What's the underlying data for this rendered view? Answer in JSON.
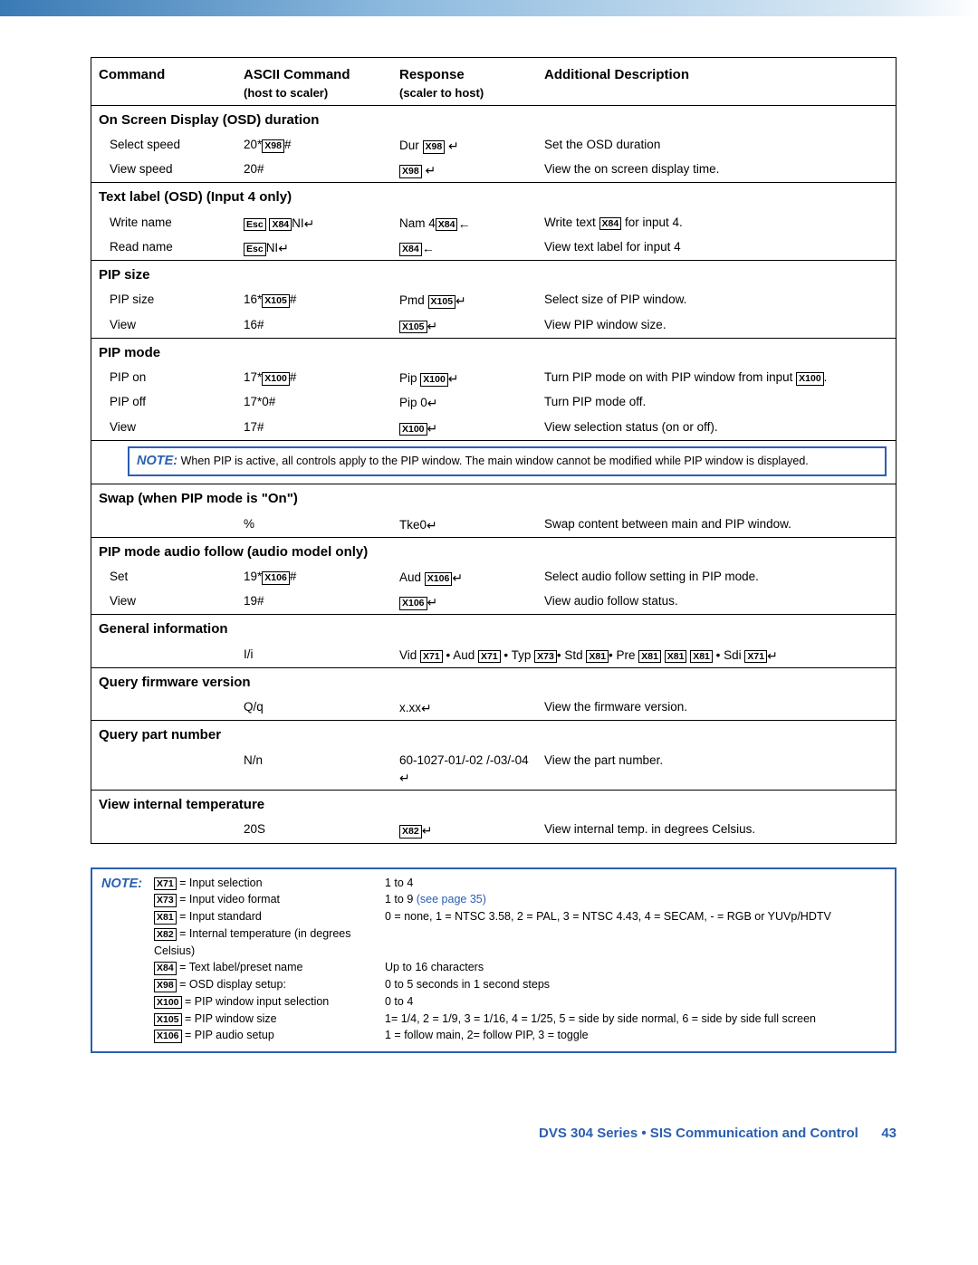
{
  "headers": {
    "c1": "Command",
    "c2": "ASCII Command",
    "c2s": "(host to scaler)",
    "c3": "Response",
    "c3s": "(scaler to host)",
    "c4": "Additional Description"
  },
  "sections": [
    {
      "title": "On Screen Display (OSD) duration",
      "rows": [
        {
          "c1": "Select speed",
          "c2": "20*|X98|#",
          "c3": "Dur |X98| ↵",
          "c4": "Set the OSD duration"
        },
        {
          "c1": "View speed",
          "c2": "20#",
          "c3": "|X98| ↵",
          "c4": "View the on screen display time."
        }
      ]
    },
    {
      "title": "Text label (OSD) (Input 4 only)",
      "rows": [
        {
          "c1": "Write name",
          "c2": "|Esc| |X84|NI↵",
          "c3": "Nam 4|X84|←",
          "c4": "Write text |X84| for input 4."
        },
        {
          "c1": "Read name",
          "c2": "|Esc|NI↵",
          "c3": "|X84|←",
          "c4": "View text label for input 4"
        }
      ]
    },
    {
      "title": "PIP size",
      "rows": [
        {
          "c1": "PIP size",
          "c2": "16*|X105|#",
          "c3": "Pmd |X105|↵",
          "c4": "Select size of PIP window."
        },
        {
          "c1": "View",
          "c2": "16#",
          "c3": "|X105|↵",
          "c4": "View PIP window size."
        }
      ]
    },
    {
      "title": "PIP mode",
      "rows": [
        {
          "c1": "PIP on",
          "c2": "17*|X100|#",
          "c3": "Pip |X100|↵",
          "c4": "Turn PIP mode on with PIP window from input |X100|."
        },
        {
          "c1": "PIP off",
          "c2": "17*0#",
          "c3": "Pip 0↵",
          "c4": "Turn PIP mode off."
        },
        {
          "c1": "View",
          "c2": "17#",
          "c3": "|X100|↵",
          "c4": "View selection status (on or off)."
        }
      ],
      "note": "When PIP is active, all controls apply to the PIP window. The main window cannot be modified while PIP window is displayed."
    },
    {
      "title": "Swap (when PIP mode is \"On\")",
      "rows": [
        {
          "c1": "",
          "c2": "%",
          "c3": "Tke0↵",
          "c4": "Swap content between main and PIP window."
        }
      ]
    },
    {
      "title": "PIP mode audio follow (audio model only)",
      "rows": [
        {
          "c1": "Set",
          "c2": "19*|X106|#",
          "c3": "Aud |X106|↵",
          "c4": "Select audio follow setting in PIP mode."
        },
        {
          "c1": "View",
          "c2": "19#",
          "c3": "|X106|↵",
          "c4": "View audio follow status."
        }
      ]
    },
    {
      "title": "General information",
      "rows": [
        {
          "c1": "",
          "c2": "I/i",
          "c3": "Vid |X71| • Aud |X71| • Typ |X73|• Std |X81|• Pre |X81|  |X81|  |X81| • Sdi |X71|↵",
          "c4": "",
          "span": true
        }
      ]
    },
    {
      "title": "Query firmware version",
      "rows": [
        {
          "c1": "",
          "c2": "Q/q",
          "c3": "x.xx↵",
          "c4": "View the firmware version."
        }
      ]
    },
    {
      "title": "Query part number",
      "rows": [
        {
          "c1": "",
          "c2": "N/n",
          "c3": "60-1027-01/-02 /-03/-04↵",
          "c4": "View the part number."
        }
      ]
    },
    {
      "title": "View internal temperature",
      "rows": [
        {
          "c1": "",
          "c2": "20S",
          "c3": "|X82|↵",
          "c4": "View internal temp. in degrees Celsius."
        }
      ]
    }
  ],
  "legend": {
    "prefix": "NOTE:",
    "items": [
      {
        "code": "X71",
        "left": "= Input selection",
        "right": "1 to 4"
      },
      {
        "code": "X73",
        "left": "= Input video format",
        "right": "1 to 9 (see page 35)",
        "link": true
      },
      {
        "code": "X81",
        "left": "= Input standard",
        "right": "0 = none, 1 = NTSC 3.58, 2 = PAL, 3 = NTSC 4.43, 4 = SECAM, - = RGB or YUVp/HDTV"
      },
      {
        "code": "X82",
        "left": "= Internal temperature (in degrees Celsius)",
        "right": ""
      },
      {
        "code": "X84",
        "left": "= Text label/preset name",
        "right": "Up to 16 characters"
      },
      {
        "code": "X98",
        "left": "= OSD display setup:",
        "right": "0 to 5 seconds in 1 second steps"
      },
      {
        "code": "X100",
        "left": "= PIP window input selection",
        "right": "0 to 4"
      },
      {
        "code": "X105",
        "left": "= PIP window size",
        "right": "1= 1/4, 2 = 1/9, 3 = 1/16, 4 = 1/25, 5 = side by side normal, 6 = side by side full screen"
      },
      {
        "code": "X106",
        "left": "= PIP audio setup",
        "right": "1 = follow main, 2= follow PIP, 3 = toggle"
      }
    ]
  },
  "footer": {
    "text": "DVS 304 Series • SIS Communication and Control",
    "page": "43"
  }
}
